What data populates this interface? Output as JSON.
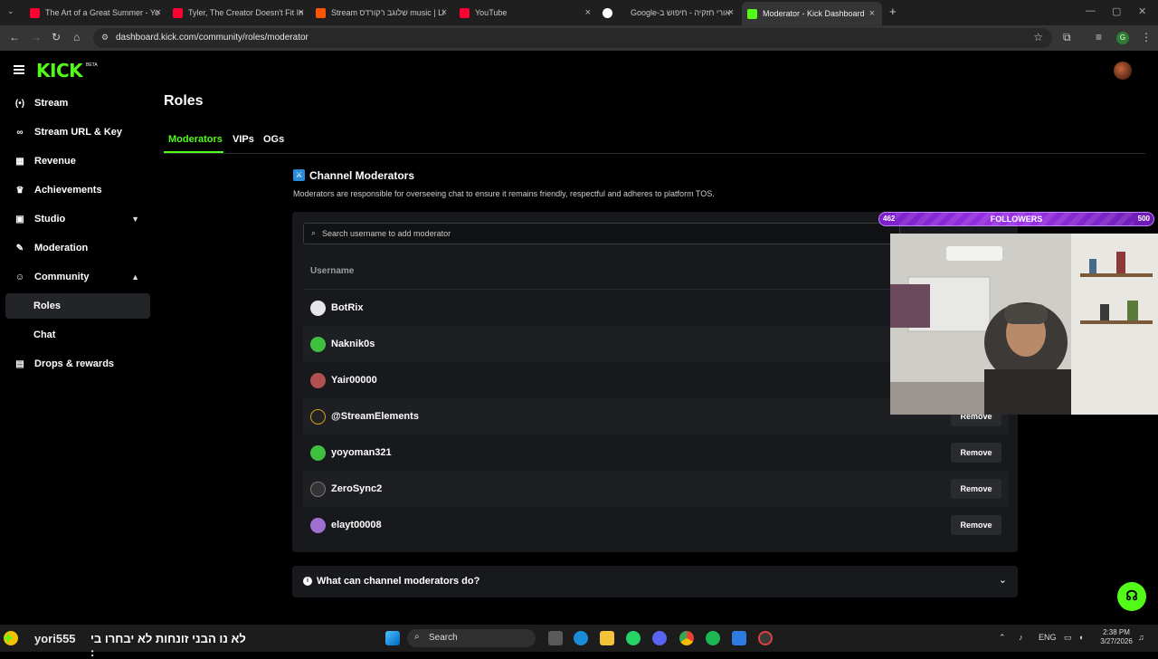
{
  "browser": {
    "tabs": [
      {
        "title": "The Art of a Great Summer - Yo",
        "favicon_color": "#ff0033"
      },
      {
        "title": "Tyler, The Creator Doesn't Fit In",
        "favicon_color": "#ff0033"
      },
      {
        "title": "Stream שלוגב רקורדס music | Li",
        "favicon_color": "#ff5500"
      },
      {
        "title": "YouTube",
        "favicon_color": "#ff0033"
      },
      {
        "title": "Google-אורי חזקיה - חיפוש ב",
        "favicon_color": "#ffffff"
      },
      {
        "title": "Moderator - Kick Dashboard",
        "favicon_color": "#53fc18"
      }
    ],
    "new_tab_glyph": "+",
    "url": "dashboard.kick.com/community/roles/moderator"
  },
  "brand": {
    "logo": "KICK",
    "badge": "BETA",
    "accent": "#53fc18"
  },
  "sidebar": {
    "items": [
      {
        "label": "Stream",
        "icon": "broadcast-icon"
      },
      {
        "label": "Stream URL & Key",
        "icon": "link-icon"
      },
      {
        "label": "Revenue",
        "icon": "chart-icon"
      },
      {
        "label": "Achievements",
        "icon": "trophy-icon"
      },
      {
        "label": "Studio",
        "icon": "studio-icon",
        "expanded": false
      },
      {
        "label": "Moderation",
        "icon": "wrench-icon"
      },
      {
        "label": "Community",
        "icon": "community-icon",
        "expanded": true
      },
      {
        "label": "Roles",
        "sub": true,
        "selected": true
      },
      {
        "label": "Chat",
        "sub": true
      },
      {
        "label": "Drops & rewards",
        "icon": "gift-icon"
      }
    ]
  },
  "main": {
    "title": "Roles",
    "tabs": [
      {
        "label": "Moderators",
        "active": true
      },
      {
        "label": "VIPs"
      },
      {
        "label": "OGs"
      }
    ],
    "section_title": "Channel Moderators",
    "section_desc": "Moderators are responsible for overseeing chat to ensure it remains friendly, respectful and adheres to platform TOS.",
    "search_placeholder": "Search username to add moderator",
    "column_header": "Username",
    "remove_label": "Remove",
    "moderators": [
      {
        "name": "BotRix",
        "avatar": "#e6e6e6"
      },
      {
        "name": "Naknik0s",
        "avatar": "#3fbf3f"
      },
      {
        "name": "Yair00000",
        "avatar": "#b05050"
      },
      {
        "name": "@StreamElements",
        "avatar": "#222222"
      },
      {
        "name": "yoyoman321",
        "avatar": "#3fbf3f"
      },
      {
        "name": "ZeroSync2",
        "avatar": "#333333"
      },
      {
        "name": "elayt00008",
        "avatar": "#a070d0"
      }
    ],
    "faq_label": "What can channel moderators do?"
  },
  "overlay": {
    "followers_label": "FOLLOWERS",
    "current": "462",
    "goal": "500"
  },
  "ticker": {
    "username": "yori555",
    "message": "לא נו הבני זונחות לא יבחרו בי :"
  },
  "taskbar": {
    "search_label": "Search",
    "lang": "ENG",
    "time": "2:38 PM",
    "date": "3/27/2026"
  }
}
